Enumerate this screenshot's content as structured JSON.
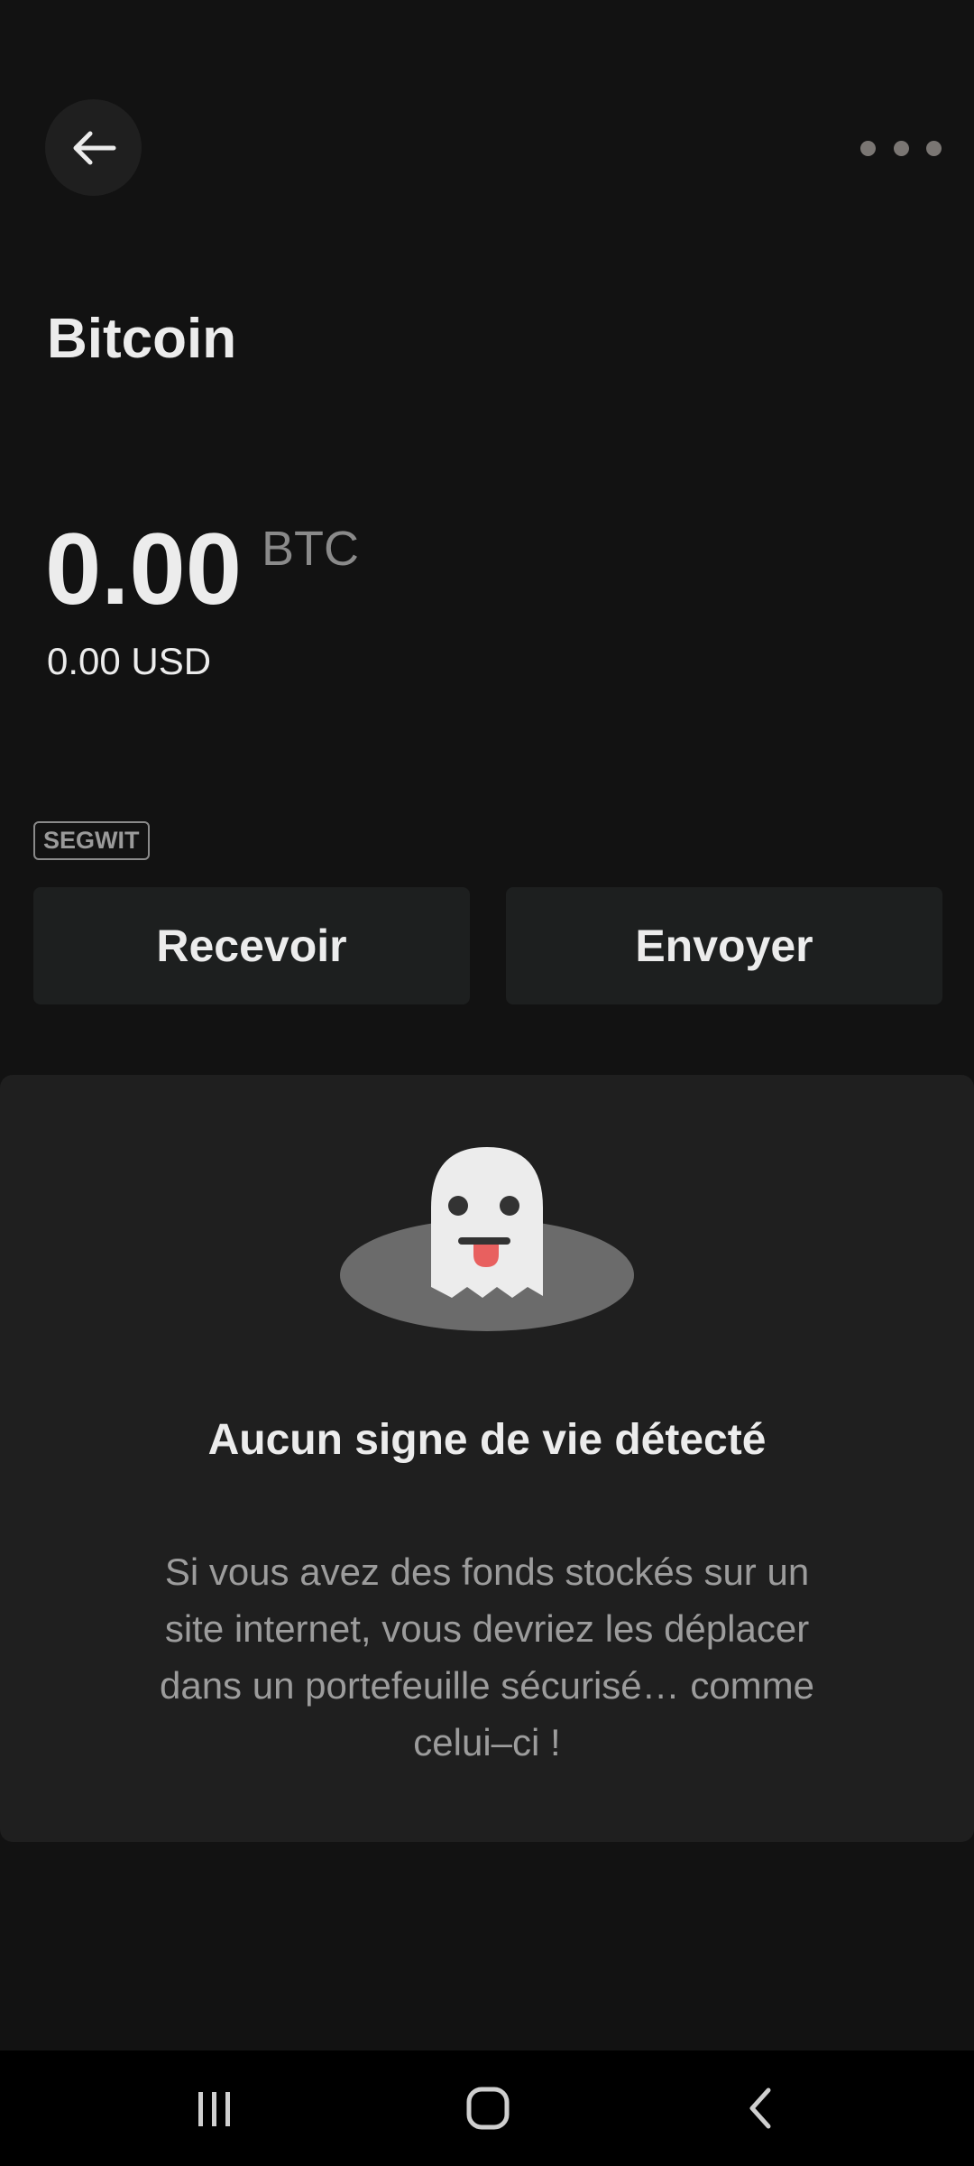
{
  "header": {
    "back_icon": "arrow-left-icon",
    "more_icon": "more-horizontal-icon"
  },
  "account": {
    "name": "Bitcoin",
    "balance": "0.00",
    "unit": "BTC",
    "fiat_value": "0.00 USD",
    "badge": "SEGWIT"
  },
  "actions": {
    "receive_label": "Recevoir",
    "send_label": "Envoyer"
  },
  "empty_state": {
    "illustration": "ghost-icon",
    "title": "Aucun signe de vie détecté",
    "description": "Si vous avez des fonds stockés sur un site internet, vous devriez les déplacer dans un portefeuille sécurisé… comme celui–ci !"
  },
  "system_nav": {
    "recents_icon": "recents-icon",
    "home_icon": "home-icon",
    "back_icon": "back-chevron-icon"
  },
  "colors": {
    "background": "#121212",
    "panel": "#1f1f1f",
    "button": "#1d1f1f",
    "text": "#ececec",
    "muted": "#8a8a8a",
    "ghost_tongue": "#e8605f"
  }
}
